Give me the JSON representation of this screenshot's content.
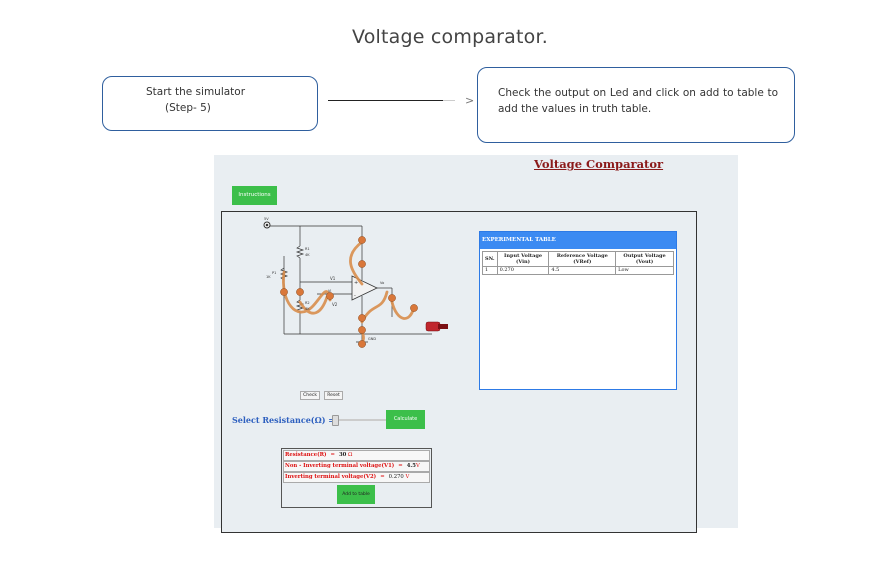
{
  "slide": {
    "title": "Voltage comparator.",
    "step1_line1": "Start the simulator",
    "step1_line2": "(Step- 5)",
    "step2_text": "Check the output on Led and click on add to table to add the values in truth table.",
    "arrow_glyph": ">"
  },
  "simulator": {
    "title": "Voltage Comparator",
    "instructions_button": "Instructions",
    "circuit": {
      "source_label": "5V",
      "r1_label": "R1",
      "r1_value": "4K",
      "r2_label": "R2",
      "r2_value": "4K",
      "pot_label": "P1",
      "pot_value": "1K",
      "vin_label": "Vi",
      "v1_label": "V1",
      "v2_label": "V2",
      "vout_label": "Vo",
      "gnd_label": "GND"
    },
    "experimental_table": {
      "title": "EXPERIMENTAL TABLE",
      "headers": [
        "SN.",
        "Input Voltage (Vin)",
        "Reference Voltage (VRef)",
        "Output Voltage (Vout)"
      ],
      "rows": [
        [
          "1",
          "0.270",
          "4.5",
          "Low"
        ]
      ]
    },
    "check_button": "Check",
    "reset_button": "Reset",
    "resistance_label": "Select Resistance(Ω)   =",
    "calculate_button": "Calculate",
    "readout": {
      "resistance_label": "Resistance(R)",
      "resistance_value": "30",
      "resistance_unit": "Ω",
      "v1_label": "Non - Inverting terminal voltage(V1)",
      "v1_value": "4.5",
      "v1_unit": "V",
      "v2_label": "Inverting terminal voltage(V2)",
      "v2_value": "0.270",
      "v2_unit": "V"
    },
    "add_to_table_button": "Add to table"
  }
}
